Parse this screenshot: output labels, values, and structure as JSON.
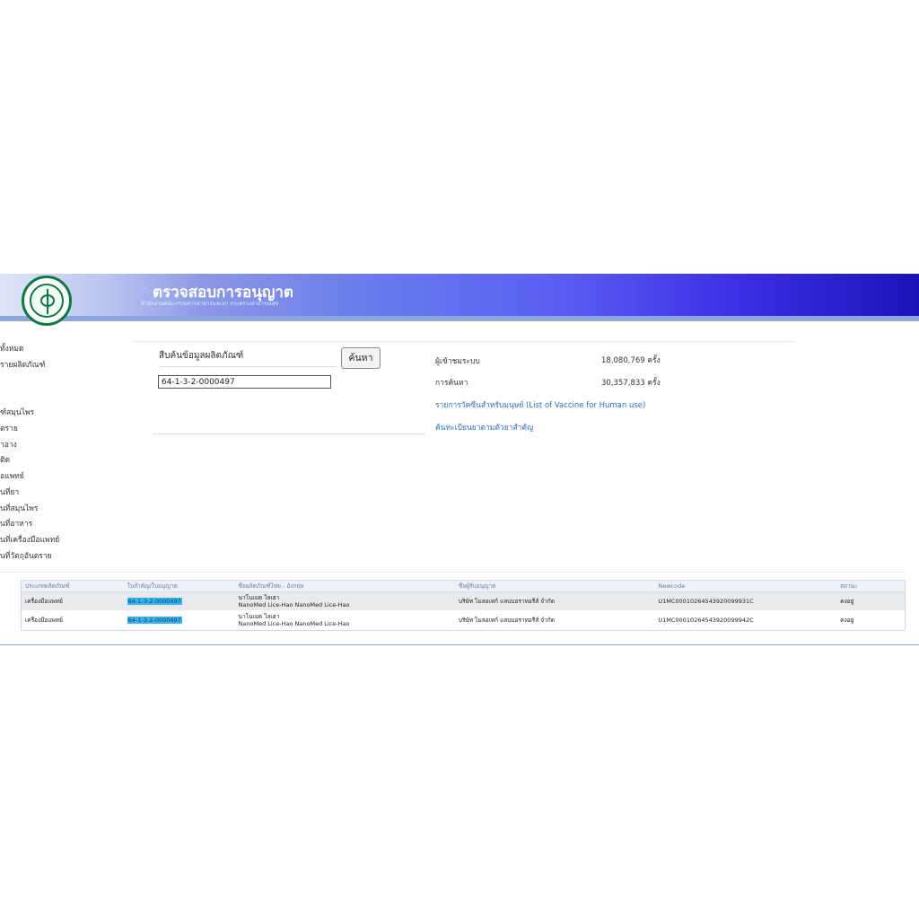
{
  "header": {
    "title": "ตรวจสอบการอนุญาต",
    "subtitle": "สำนักงานคณะกรรมการอาหารและยา กระทรวงสาธารณสุข",
    "brand_color": "#5b5ff3",
    "logo_icon": "moph-emblem"
  },
  "sidenav": {
    "items": [
      "ทั้งหมด",
      "รายผลิตภัณฑ์",
      "ฑ์สมุนไพร",
      "ตราย",
      "ำอาง",
      "ติด",
      "อแพทย์",
      "นที่ยา",
      "นที่สมุนไพร",
      "นที่อาหาร",
      "นที่เครื่องมือแพทย์",
      "นที่วัตถุอันตราย"
    ]
  },
  "search": {
    "label": "สืบค้นข้อมูลผลิตภัณฑ์",
    "button_label": "ค้นหา",
    "input_value": "64-1-3-2-0000497"
  },
  "stats": {
    "visitors_label": "ผู้เข้าชมระบบ",
    "visitors_value": "18,080,769 ครั้ง",
    "searches_label": "การค้นหา",
    "searches_value": "30,357,833 ครั้ง"
  },
  "links": {
    "vaccine": "รายการวัคซีนสำหรับมนุษย์ (List of Vaccine for Human use)",
    "registry": "ค้นทะเบียนยาตามตัวยาสำคัญ"
  },
  "table": {
    "columns": [
      "ประเภทผลิตภัณฑ์",
      "ใบสำคัญ/ใบอนุญาต",
      "ชื่อผลิตภัณฑ์ไทย - อังกฤษ",
      "ชื่อผู้รับอนุญาต",
      "Newcode",
      "สถานะ"
    ],
    "rows": [
      {
        "type": "เครื่องมือแพทย์",
        "license": "64-1-3-2-0000497",
        "name_th": "นาโนเมด ไลเฮา",
        "name_en": "NanoMed Lice-Hao NanoMed Lice-Hao",
        "company": "บริษัท ไมลอเทก์ แลบบอราทอรีส์ จำกัด",
        "newcode": "U1MC00010264543920099931C",
        "status": "คงอยู่"
      },
      {
        "type": "เครื่องมือแพทย์",
        "license": "64-1-3-2-0000497",
        "name_th": "นาโนเมด ไลเฮา",
        "name_en": "NanoMed Lice-Hao NanoMed Lice-Hao",
        "company": "บริษัท ไมลอเทก์ แลบบอราทอรีส์ จำกัด",
        "newcode": "U1MC00010264543920099942C",
        "status": "คงอยู่"
      }
    ]
  }
}
